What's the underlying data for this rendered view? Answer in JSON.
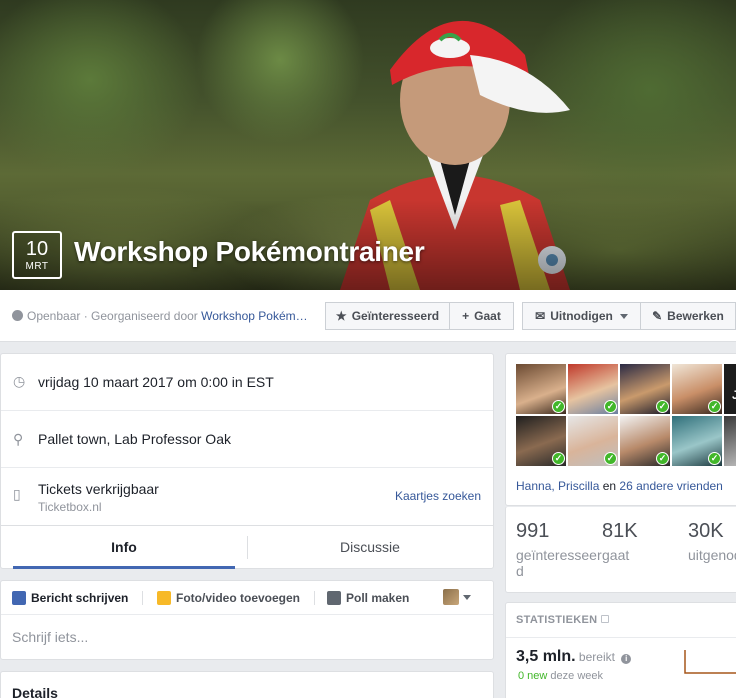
{
  "cover": {
    "date_day": "10",
    "date_month": "MRT",
    "title": "Workshop Pokémontrainer"
  },
  "actionbar": {
    "privacy": "Openbaar",
    "organizer_prefix": "· Georganiseerd door",
    "organizer_link": "Workshop Pokém…",
    "interested_label": "Geïnteresseerd",
    "going_label": "Gaat",
    "invite_label": "Uitnodigen",
    "edit_label": "Bewerken"
  },
  "info": {
    "datetime": "vrijdag 10 maart 2017 om 0:00 in EST",
    "location": "Pallet town, Lab Professor Oak",
    "tickets_title": "Tickets verkrijgbaar",
    "tickets_source": "Ticketbox.nl",
    "tickets_link": "Kaartjes zoeken",
    "tabs": [
      "Info",
      "Discussie"
    ]
  },
  "composer": {
    "write_post": "Bericht schrijven",
    "add_photo": "Foto/video toevoegen",
    "make_poll": "Poll maken",
    "placeholder": "Schrijf iets..."
  },
  "details": {
    "heading": "Details"
  },
  "friends": {
    "names": "Hanna, Priscilla",
    "and": "en",
    "others_link": "26 andere vrienden",
    "overlay_letter": "J"
  },
  "stats": {
    "interested_count": "991",
    "interested_label_a": "geïnteresseer",
    "interested_label_b": "d",
    "going_count": "81K",
    "going_label": "gaat",
    "invited_count": "30K",
    "invited_label": "uitgenod"
  },
  "insights": {
    "title": "STATISTIEKEN",
    "reach_value": "3,5 mln.",
    "reach_label": "bereikt",
    "new_count": "0 new",
    "new_period": "deze week"
  },
  "colors": {
    "link": "#365899",
    "accent": "#4267b2",
    "check": "#42b72a",
    "spark": "#a5561a"
  }
}
